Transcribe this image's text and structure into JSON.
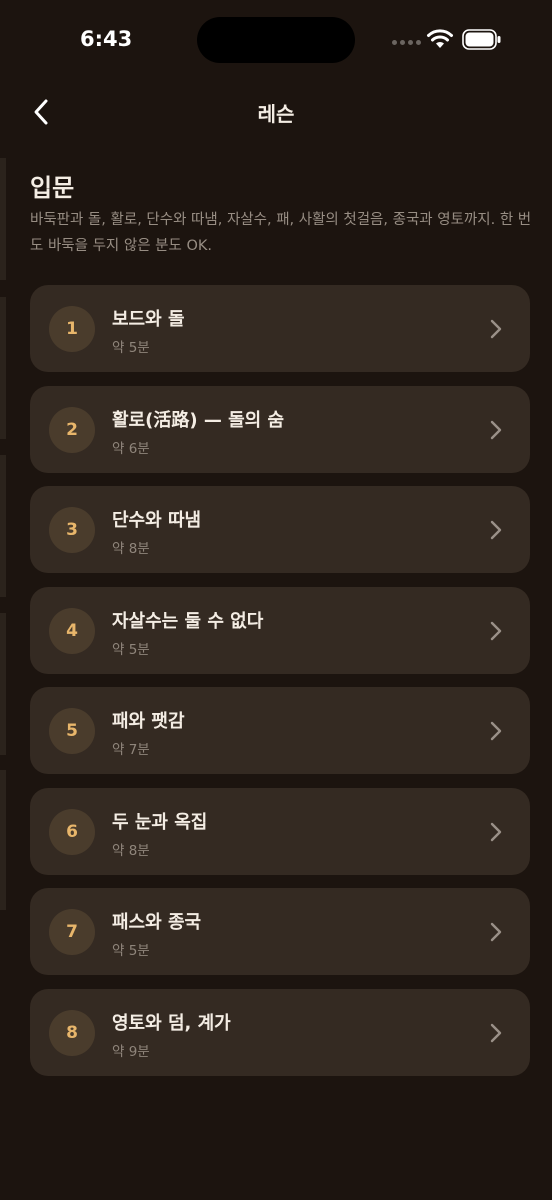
{
  "status_bar": {
    "time": "6:43"
  },
  "nav": {
    "title": "레슨"
  },
  "section": {
    "title": "입문",
    "description": "바둑판과 돌, 활로, 단수와 따냄, 자살수, 패, 사활의 첫걸음, 종국과 영토까지. 한 번도 바둑을 두지 않은 분도 OK."
  },
  "lessons": [
    {
      "number": "1",
      "title": "보드와 돌",
      "duration": "약 5분"
    },
    {
      "number": "2",
      "title": "활로(活路) — 돌의 숨",
      "duration": "약 6분"
    },
    {
      "number": "3",
      "title": "단수와 따냄",
      "duration": "약 8분"
    },
    {
      "number": "4",
      "title": "자살수는 둘 수 없다",
      "duration": "약 5분"
    },
    {
      "number": "5",
      "title": "패와 팻감",
      "duration": "약 7분"
    },
    {
      "number": "6",
      "title": "두 눈과 옥집",
      "duration": "약 8분"
    },
    {
      "number": "7",
      "title": "패스와 종국",
      "duration": "약 5분"
    },
    {
      "number": "8",
      "title": "영토와 덤, 계가",
      "duration": "약 9분"
    }
  ],
  "colors": {
    "background": "#1c140f",
    "card": "#342a22",
    "accent_number": "#e8b66b",
    "number_bg": "#4a3c2c"
  }
}
